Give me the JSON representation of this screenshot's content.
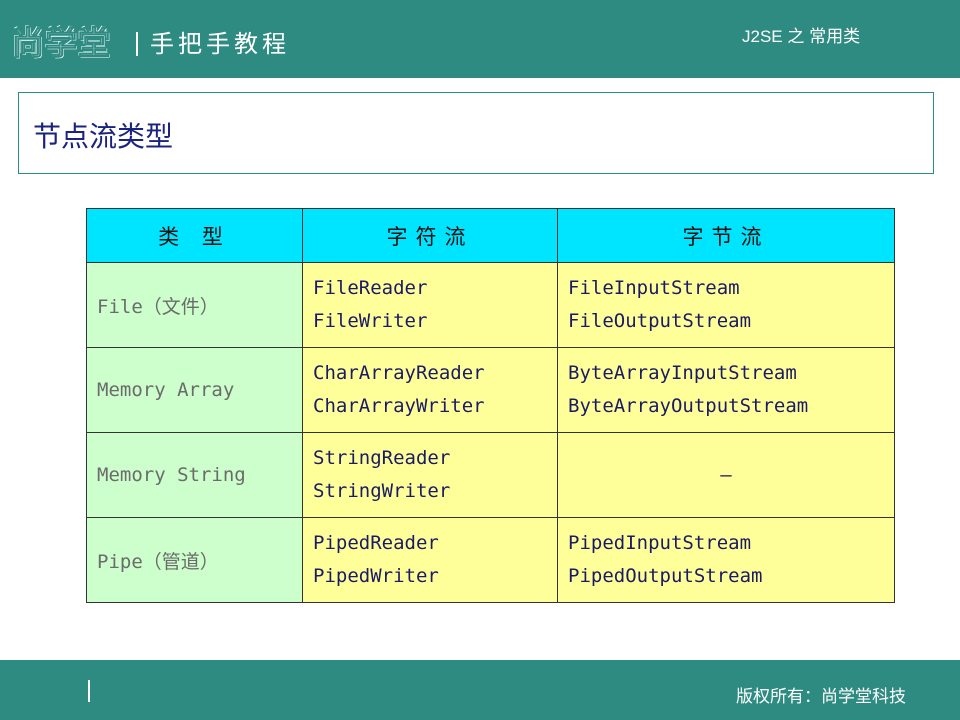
{
  "header": {
    "logo_text": "尚学堂",
    "slogan": "手把手教程",
    "subject": "J2SE 之 常用类"
  },
  "slide": {
    "title": "节点流类型"
  },
  "table": {
    "headers": [
      "类 型",
      "字符流",
      "字节流"
    ],
    "rows": [
      {
        "type": "File（文件）",
        "char": [
          "FileReader",
          "FileWriter"
        ],
        "byte": [
          "FileInputStream",
          "FileOutputStream"
        ]
      },
      {
        "type": "Memory Array",
        "char": [
          "CharArrayReader",
          "CharArrayWriter"
        ],
        "byte": [
          "ByteArrayInputStream",
          "ByteArrayOutputStream"
        ]
      },
      {
        "type": "Memory String",
        "char": [
          "StringReader",
          "StringWriter"
        ],
        "byte": [
          "—"
        ]
      },
      {
        "type": "Pipe（管道）",
        "char": [
          "PipedReader",
          "PipedWriter"
        ],
        "byte": [
          "PipedInputStream",
          "PipedOutputStream"
        ]
      }
    ]
  },
  "footer": {
    "copyright": "版权所有：尚学堂科技"
  },
  "colors": {
    "brand_teal": "#2e8b82",
    "header_cyan": "#00e5ff",
    "type_green": "#ccffcc",
    "class_yellow": "#ffff99"
  }
}
